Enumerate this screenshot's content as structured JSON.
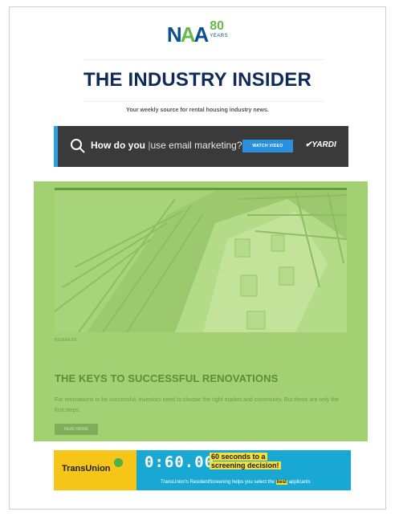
{
  "logo": {
    "naa_n": "N",
    "naa_a1": "A",
    "naa_a2": "A",
    "years_num": "80",
    "years_label": "YEARS"
  },
  "header": {
    "title": "THE INDUSTRY INSIDER",
    "tagline": "Your weekly source for rental housing industry news."
  },
  "banner": {
    "question_bold": "How do you",
    "question_rest": "use email marketing?",
    "cta_label": "WATCH VIDEO",
    "brand": "YARDI"
  },
  "article": {
    "category": "BUSINESS",
    "title": "THE KEYS TO SUCCESSFUL RENOVATIONS",
    "description": "For renovations to be successful, investors need to choose the right market and community. But these are only the first steps.",
    "cta_label": "READ MORE"
  },
  "ad": {
    "brand": "TransUnion",
    "timer": "0:60.00",
    "headline_line1": "60 seconds to a",
    "headline_line2": "screening decision!",
    "sub_prefix": "TransUnion's ResidentScreening helps you select the",
    "sub_highlight": "best",
    "sub_suffix": "applicants"
  },
  "colors": {
    "brand_blue": "#0b4f8e",
    "brand_green": "#69b84a",
    "overlay_green": "#a2d072",
    "transunion_yellow": "#f5c518",
    "ad_blue": "#19a8d4"
  }
}
